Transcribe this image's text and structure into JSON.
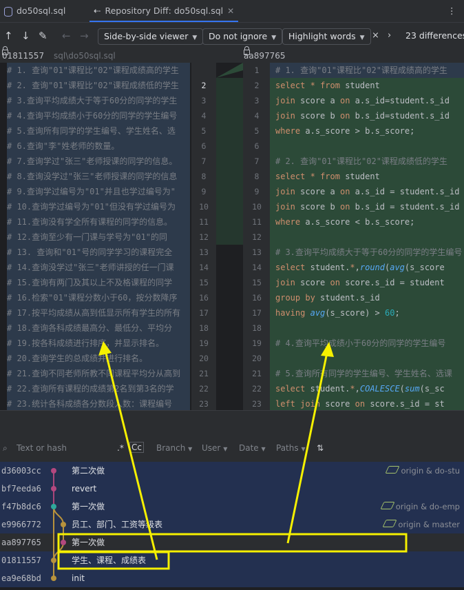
{
  "tabs": [
    {
      "label": "do50sql.sql",
      "icon": "database-icon"
    },
    {
      "label": "Repository Diff: do50sql.sql",
      "icon": "diff-icon"
    }
  ],
  "toolbar": {
    "viewer": "Side-by-side viewer",
    "whitespace": "Do not ignore",
    "highlight": "Highlight words",
    "differences": "23 differences"
  },
  "headers": {
    "left_hash": "01811557",
    "left_path": "sql\\do50sql.sql",
    "right_hash": "aa897765"
  },
  "left_lines": [
    "# 1. 查询\"01\"课程比\"02\"课程成绩高的学生",
    "# 2. 查询\"01\"课程比\"02\"课程成绩低的学生",
    "# 3.查询平均成绩大于等于60分的同学的学生",
    "# 4.查询平均成绩小于60分的同学的学生编号",
    "# 5.查询所有同学的学生编号、学生姓名、选",
    "# 6.查询\"李\"姓老师的数量。",
    "# 7.查询学过\"张三\"老师授课的同学的信息。",
    "# 8.查询没学过\"张三\"老师授课的同学的信息",
    "# 9.查询学过编号为\"01\"并且也学过编号为\"",
    "# 10.查询学过编号为\"01\"但没有学过编号为",
    "# 11.查询没有学全所有课程的同学的信息。",
    "# 12.查询至少有一门课与学号为\"01\"的同",
    "# 13. 查询和\"01\"号的同学学习的课程完全",
    "# 14.查询没学过\"张三\"老师讲授的任一门课",
    "# 15.查询有两门及其以上不及格课程的同学",
    "# 16.检索\"01\"课程分数小于60，按分数降序",
    "# 17.按平均成绩从高到低显示所有学生的所有",
    "# 18.查询各科成绩最高分、最低分、平均分",
    "# 19.按各科成绩进行排序，并显示排名。",
    "# 20.查询学生的总成绩并进行排名。",
    "# 21.查询不同老师所教不同课程平均分从高到",
    "# 22.查询所有课程的成绩第2名到第3名的学",
    "# 23.统计各科成绩各分数段人数：课程编号"
  ],
  "left_nums": [
    "",
    "2",
    "3",
    "4",
    "5",
    "6",
    "7",
    "8",
    "9",
    "10",
    "11",
    "12",
    "13",
    "14",
    "15",
    "16",
    "17",
    "18",
    "19",
    "20",
    "21",
    "22",
    "23"
  ],
  "right_nums": [
    "1",
    "2",
    "3",
    "4",
    "5",
    "6",
    "7",
    "8",
    "9",
    "10",
    "11",
    "12",
    "13",
    "14",
    "15",
    "16",
    "17",
    "18",
    "19",
    "20",
    "21",
    "22",
    "23"
  ],
  "right_lines": [
    "# 1. 查询\"01\"课程比\"02\"课程成绩高的学生",
    "select * from student",
    "join score a on a.s_id=student.s_id",
    "join score b on b.s_id=student.s_id",
    "where a.s_score > b.s_score;",
    "",
    "# 2. 查询\"01\"课程比\"02\"课程成绩低的学生",
    "select * from student",
    "join score a on a.s_id = student.s_id",
    "join score b on b.s_id = student.s_id",
    "where a.s_score < b.s_score;",
    "",
    "# 3.查询平均成绩大于等于60分的同学的学生编号",
    "select student.*,round(avg(s_score",
    "join score on score.s_id = student",
    "group by student.s_id",
    "having avg(s_score) > 60;",
    "",
    "# 4.查询平均成绩小于60分的同学的学生编号",
    "",
    "# 5.查询所有同学的学生编号、学生姓名、选课",
    "select student.*,COALESCE(sum(s_sc",
    "left join score on score.s_id = st"
  ],
  "log_toolbar": {
    "search_placeholder": "Text or hash",
    "regex": ".*",
    "case": "Cc",
    "branch": "Branch",
    "user": "User",
    "date": "Date",
    "paths": "Paths"
  },
  "commits": [
    {
      "hash": "d36003cc",
      "message": "第二次做",
      "ref": "origin & do-stu"
    },
    {
      "hash": "bf7eeda6",
      "message": "revert",
      "ref": ""
    },
    {
      "hash": "f47b8dc6",
      "message": "第一次做",
      "ref": "origin & do-emp"
    },
    {
      "hash": "e9966772",
      "message": "员工、部门、工资等级表",
      "ref": "origin & master"
    },
    {
      "hash": "aa897765",
      "message": "第一次做",
      "ref": ""
    },
    {
      "hash": "01811557",
      "message": "学生、课程、成绩表",
      "ref": ""
    },
    {
      "hash": "ea9e68bd",
      "message": "init",
      "ref": ""
    }
  ],
  "colors": {
    "accent": "#3574f0",
    "annotation": "#f5f000",
    "added_bg": "#2c4a38",
    "selected_row": "#2e436e"
  }
}
